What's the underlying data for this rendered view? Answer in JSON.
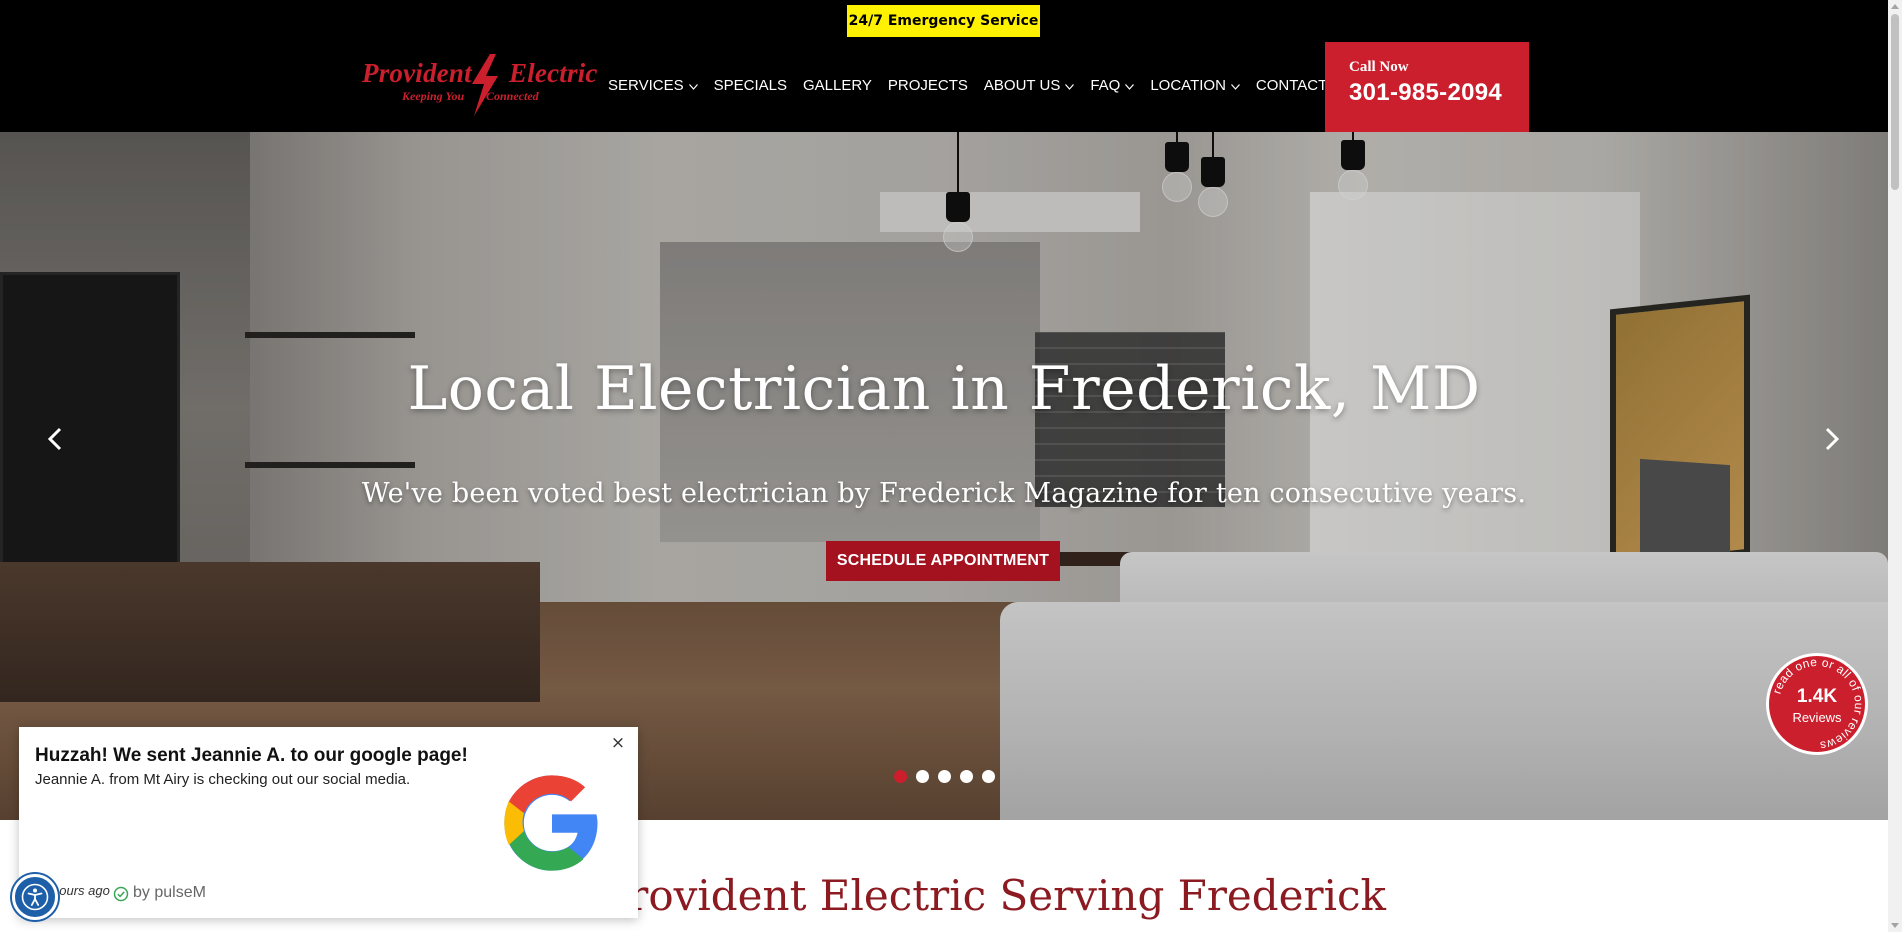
{
  "header": {
    "emergency_label": "24/7 Emergency Service",
    "logo": {
      "word1": "Provident",
      "word2": "Electric",
      "tag1": "Keeping You",
      "tag2": "Connected"
    },
    "nav": [
      {
        "label": "SERVICES",
        "has_dropdown": true
      },
      {
        "label": "SPECIALS",
        "has_dropdown": false
      },
      {
        "label": "GALLERY",
        "has_dropdown": false
      },
      {
        "label": "PROJECTS",
        "has_dropdown": false
      },
      {
        "label": "ABOUT US",
        "has_dropdown": true
      },
      {
        "label": "FAQ",
        "has_dropdown": true
      },
      {
        "label": "LOCATION",
        "has_dropdown": true
      },
      {
        "label": "CONTACT US",
        "has_dropdown": true
      }
    ],
    "call": {
      "label": "Call Now",
      "number": "301-985-2094"
    }
  },
  "hero": {
    "title": "Local Electrician in Frederick, MD",
    "subtitle": "We've been voted best electrician by Frederick Magazine for ten consecutive years.",
    "cta_label": "SCHEDULE APPOINTMENT",
    "slide_count": 5,
    "active_slide": 1,
    "reviews_badge": {
      "count": "1.4K",
      "label": "Reviews",
      "ring_text": "read one or all of our reviews"
    }
  },
  "section": {
    "title": "Provident Electric Serving Frederick"
  },
  "popup": {
    "title": "Huzzah! We sent Jeannie A. to our google page!",
    "message": "Jeannie A. from Mt Airy is checking out our social media.",
    "time": "hours ago",
    "by": "by pulseM",
    "close_icon": "×"
  },
  "colors": {
    "brand_red": "#cc1f2d",
    "cta_red": "#a3121e",
    "emergency_yellow": "#fff200",
    "header_bg": "#000000",
    "section_title": "#8b1a21",
    "a11y_blue": "#1d5fa8"
  },
  "icons": {
    "nav_dropdown": "chevron-down-icon",
    "prev": "chevron-left-icon",
    "next": "chevron-right-icon",
    "google": "google-g-logo",
    "verified": "check-circle-icon",
    "accessibility": "accessibility-icon"
  }
}
